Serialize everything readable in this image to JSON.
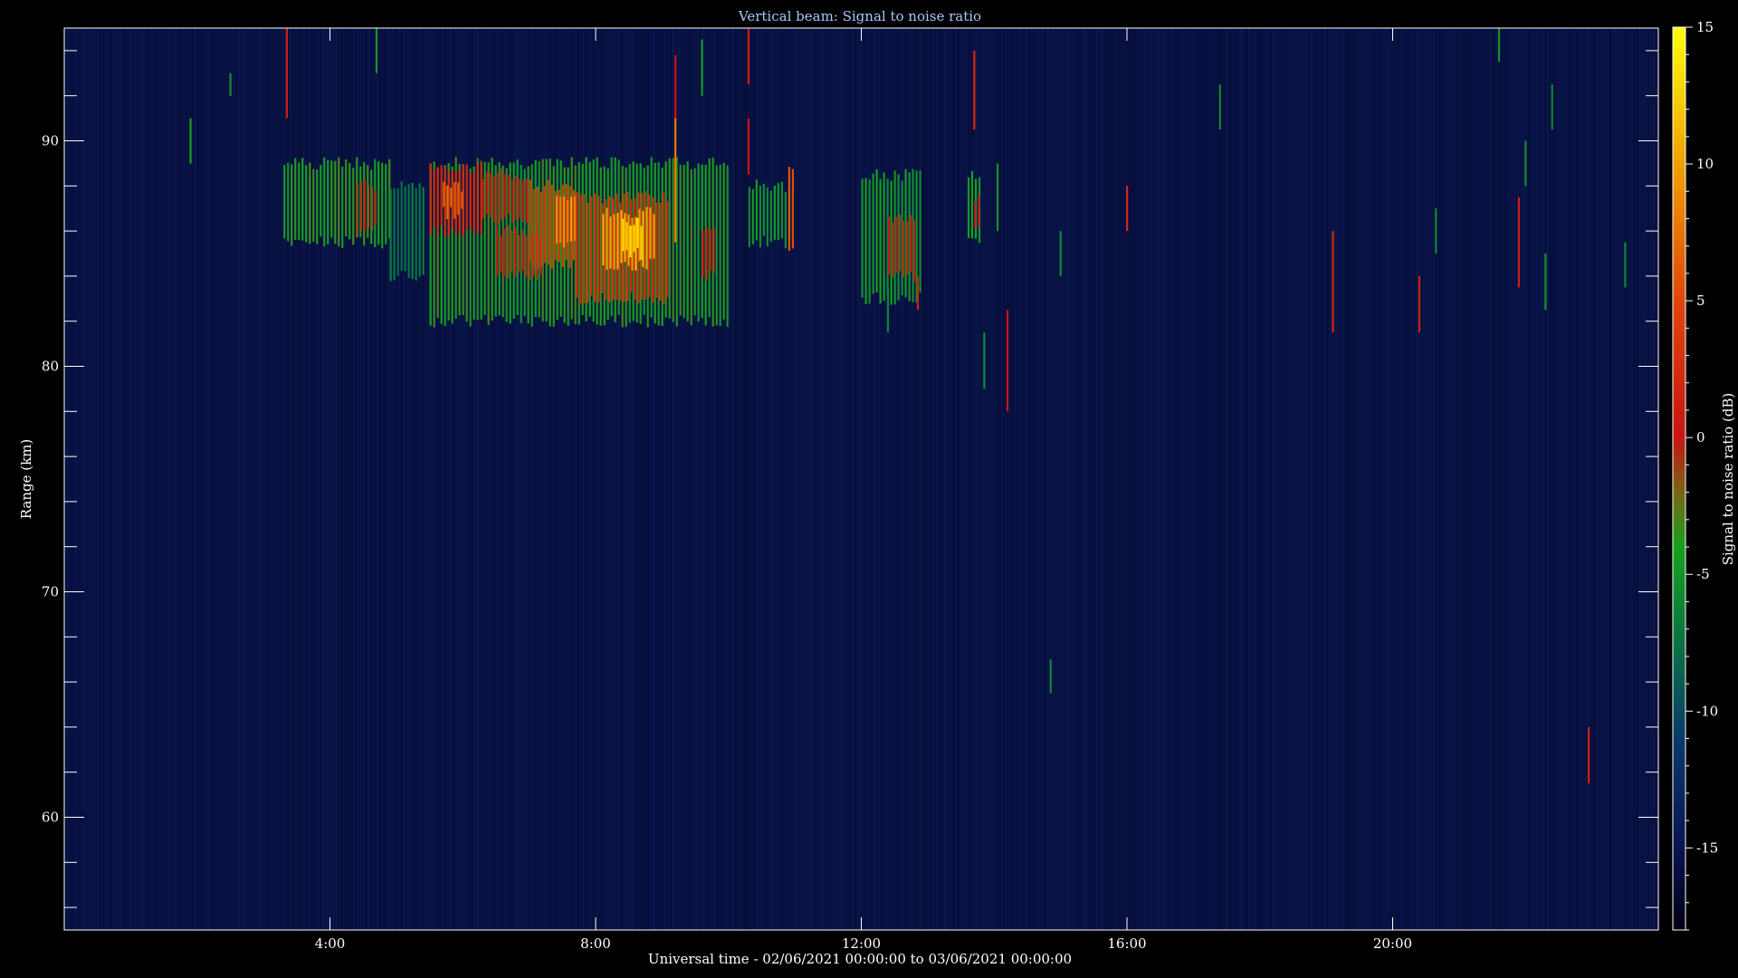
{
  "chart_data": {
    "type": "heatmap",
    "title": "Vertical beam: Signal to noise ratio",
    "xlabel": "Universal time - 02/06/2021 00:00:00 to 03/06/2021 00:00:00",
    "ylabel": "Range (km)",
    "colorbar_label": "Signal to noise ratio (dB)",
    "x_range_hours": [
      0,
      24
    ],
    "x_ticks": [
      {
        "hours": 4,
        "label": "4:00"
      },
      {
        "hours": 8,
        "label": "8:00"
      },
      {
        "hours": 12,
        "label": "12:00"
      },
      {
        "hours": 16,
        "label": "16:00"
      },
      {
        "hours": 20,
        "label": "20:00"
      }
    ],
    "y_range_km": [
      55,
      95
    ],
    "y_ticks": [
      {
        "value": 60,
        "label": "60"
      },
      {
        "value": 70,
        "label": "70"
      },
      {
        "value": 80,
        "label": "80"
      },
      {
        "value": 90,
        "label": "90"
      }
    ],
    "colorbar_range_db": [
      -18,
      15
    ],
    "colorbar_ticks": [
      {
        "value": 15,
        "label": "15"
      },
      {
        "value": 10,
        "label": "10"
      },
      {
        "value": 5,
        "label": "5"
      },
      {
        "value": 0,
        "label": "0"
      },
      {
        "value": -5,
        "label": "-5"
      },
      {
        "value": -10,
        "label": "-10"
      },
      {
        "value": -15,
        "label": "-15"
      }
    ],
    "colormap": [
      {
        "db": -18,
        "color": "#000014"
      },
      {
        "db": -15,
        "color": "#0a1450"
      },
      {
        "db": -11,
        "color": "#0a3a6a"
      },
      {
        "db": -7,
        "color": "#0a7a40"
      },
      {
        "db": -4,
        "color": "#17a11c"
      },
      {
        "db": -2,
        "color": "#7a6414"
      },
      {
        "db": 0,
        "color": "#c81414"
      },
      {
        "db": 5,
        "color": "#e0460a"
      },
      {
        "db": 10,
        "color": "#f0a000"
      },
      {
        "db": 15,
        "color": "#ffff00"
      }
    ],
    "background_db": -15,
    "echo_regions": [
      {
        "t_start": 3.3,
        "t_end": 4.9,
        "r_bottom": 85.5,
        "r_top": 89.0,
        "snr_db": -4
      },
      {
        "t_start": 4.4,
        "t_end": 4.7,
        "r_bottom": 86.0,
        "r_top": 88.0,
        "snr_db": -1
      },
      {
        "t_start": 4.9,
        "t_end": 5.4,
        "r_bottom": 84.0,
        "r_top": 88.0,
        "snr_db": -7
      },
      {
        "t_start": 5.5,
        "t_end": 10.0,
        "r_bottom": 82.0,
        "r_top": 89.0,
        "snr_db": -4
      },
      {
        "t_start": 5.5,
        "t_end": 6.3,
        "r_bottom": 86.0,
        "r_top": 88.8,
        "snr_db": 2
      },
      {
        "t_start": 5.7,
        "t_end": 6.0,
        "r_bottom": 86.8,
        "r_top": 88.0,
        "snr_db": 7
      },
      {
        "t_start": 6.3,
        "t_end": 7.0,
        "r_bottom": 86.5,
        "r_top": 88.5,
        "snr_db": 0
      },
      {
        "t_start": 6.5,
        "t_end": 7.2,
        "r_bottom": 84.0,
        "r_top": 86.0,
        "snr_db": 0
      },
      {
        "t_start": 7.0,
        "t_end": 7.7,
        "r_bottom": 84.5,
        "r_top": 88.0,
        "snr_db": 3
      },
      {
        "t_start": 7.4,
        "t_end": 7.7,
        "r_bottom": 85.5,
        "r_top": 87.5,
        "snr_db": 9
      },
      {
        "t_start": 7.7,
        "t_end": 9.1,
        "r_bottom": 83.0,
        "r_top": 87.5,
        "snr_db": 2
      },
      {
        "t_start": 8.1,
        "t_end": 8.9,
        "r_bottom": 84.5,
        "r_top": 86.8,
        "snr_db": 10
      },
      {
        "t_start": 8.4,
        "t_end": 8.7,
        "r_bottom": 85.0,
        "r_top": 86.5,
        "snr_db": 13
      },
      {
        "t_start": 9.6,
        "t_end": 9.8,
        "r_bottom": 84.0,
        "r_top": 86.0,
        "snr_db": 1
      },
      {
        "t_start": 10.3,
        "t_end": 11.0,
        "r_bottom": 85.5,
        "r_top": 88.0,
        "snr_db": -5
      },
      {
        "t_start": 10.9,
        "t_end": 11.0,
        "r_bottom": 85.0,
        "r_top": 89.0,
        "snr_db": 5
      },
      {
        "t_start": 12.0,
        "t_end": 12.9,
        "r_bottom": 83.0,
        "r_top": 88.5,
        "snr_db": -5
      },
      {
        "t_start": 12.4,
        "t_end": 12.8,
        "r_bottom": 84.0,
        "r_top": 86.5,
        "snr_db": 0
      },
      {
        "t_start": 13.6,
        "t_end": 13.8,
        "r_bottom": 85.5,
        "r_top": 88.5,
        "snr_db": -4
      },
      {
        "t_start": 13.7,
        "t_end": 13.8,
        "r_bottom": 86.0,
        "r_top": 87.5,
        "snr_db": 0
      }
    ],
    "streaks": [
      {
        "t": 3.35,
        "r_bottom": 91.0,
        "r_top": 95.0,
        "snr_db": 1
      },
      {
        "t": 1.9,
        "r_bottom": 89.0,
        "r_top": 91.0,
        "snr_db": -4
      },
      {
        "t": 2.5,
        "r_bottom": 92.0,
        "r_top": 93.0,
        "snr_db": -5
      },
      {
        "t": 4.7,
        "r_bottom": 93.0,
        "r_top": 95.0,
        "snr_db": -5
      },
      {
        "t": 9.2,
        "r_bottom": 85.5,
        "r_top": 91.0,
        "snr_db": 8
      },
      {
        "t": 9.2,
        "r_bottom": 91.0,
        "r_top": 93.8,
        "snr_db": 0
      },
      {
        "t": 9.6,
        "r_bottom": 92.0,
        "r_top": 94.5,
        "snr_db": -5
      },
      {
        "t": 10.3,
        "r_bottom": 92.5,
        "r_top": 95.0,
        "snr_db": 1
      },
      {
        "t": 10.3,
        "r_bottom": 88.5,
        "r_top": 91.0,
        "snr_db": 0
      },
      {
        "t": 12.4,
        "r_bottom": 81.5,
        "r_top": 83.5,
        "snr_db": -6
      },
      {
        "t": 12.85,
        "r_bottom": 82.5,
        "r_top": 84.0,
        "snr_db": 1
      },
      {
        "t": 13.7,
        "r_bottom": 90.5,
        "r_top": 94.0,
        "snr_db": 2
      },
      {
        "t": 14.05,
        "r_bottom": 86.0,
        "r_top": 89.0,
        "snr_db": -5
      },
      {
        "t": 13.85,
        "r_bottom": 79.0,
        "r_top": 81.5,
        "snr_db": -6
      },
      {
        "t": 14.2,
        "r_bottom": 78.0,
        "r_top": 82.5,
        "snr_db": 0
      },
      {
        "t": 15.0,
        "r_bottom": 84.0,
        "r_top": 86.0,
        "snr_db": -6
      },
      {
        "t": 16.0,
        "r_bottom": 86.0,
        "r_top": 88.0,
        "snr_db": 2
      },
      {
        "t": 17.4,
        "r_bottom": 90.5,
        "r_top": 92.5,
        "snr_db": -6
      },
      {
        "t": 19.1,
        "r_bottom": 81.5,
        "r_top": 86.0,
        "snr_db": 2
      },
      {
        "t": 20.4,
        "r_bottom": 81.5,
        "r_top": 84.0,
        "snr_db": 1
      },
      {
        "t": 20.65,
        "r_bottom": 85.0,
        "r_top": 87.0,
        "snr_db": -6
      },
      {
        "t": 21.6,
        "r_bottom": 93.5,
        "r_top": 95.0,
        "snr_db": -5
      },
      {
        "t": 21.9,
        "r_bottom": 83.5,
        "r_top": 87.5,
        "snr_db": 1
      },
      {
        "t": 22.0,
        "r_bottom": 88.0,
        "r_top": 90.0,
        "snr_db": -6
      },
      {
        "t": 22.3,
        "r_bottom": 82.5,
        "r_top": 85.0,
        "snr_db": -5
      },
      {
        "t": 22.4,
        "r_bottom": 90.5,
        "r_top": 92.5,
        "snr_db": -6
      },
      {
        "t": 22.95,
        "r_bottom": 61.5,
        "r_top": 64.0,
        "snr_db": 1
      },
      {
        "t": 23.5,
        "r_bottom": 83.5,
        "r_top": 85.5,
        "snr_db": -6
      },
      {
        "t": 14.85,
        "r_bottom": 65.5,
        "r_top": 67.0,
        "snr_db": -6
      }
    ]
  }
}
